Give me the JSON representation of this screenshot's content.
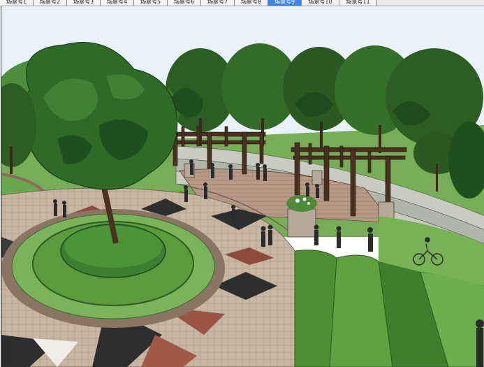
{
  "tabs": [
    {
      "label": "场景号1",
      "active": false
    },
    {
      "label": "场景号2",
      "active": false
    },
    {
      "label": "场景号3",
      "active": false
    },
    {
      "label": "场景号4",
      "active": false
    },
    {
      "label": "场景号5",
      "active": false
    },
    {
      "label": "场景号6",
      "active": false
    },
    {
      "label": "场景号7",
      "active": false
    },
    {
      "label": "场景号8",
      "active": false
    },
    {
      "label": "场景号9",
      "active": true
    },
    {
      "label": "场景号10",
      "active": false
    },
    {
      "label": "场景号11",
      "active": false
    }
  ],
  "colors": {
    "sky": "#e9f2fb",
    "tree_dark": "#1f4f1f",
    "tree_mid": "#3c7a30",
    "lawn": "#6aa84f",
    "paving": "#c9b8a4",
    "pergola": "#4a3021"
  }
}
